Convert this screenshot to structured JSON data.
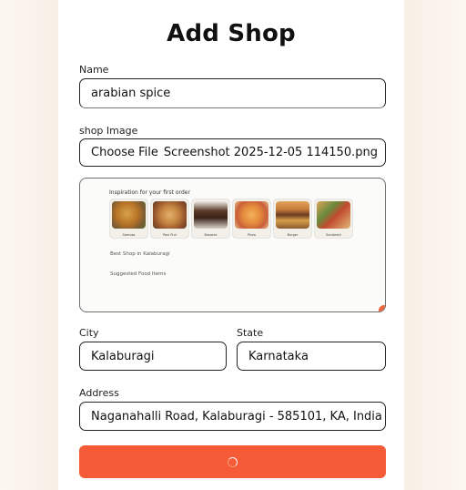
{
  "form": {
    "title": "Add Shop",
    "name_label": "Name",
    "name_value": "arabian spice",
    "image_label": "shop Image",
    "file_button_label": "Choose File",
    "file_name": "Screenshot 2025-12-05 114150.png",
    "preview": {
      "heading": "Inspiration for your first order",
      "items": [
        "Samosa",
        "Pani Puri",
        "Brownie",
        "Pizza",
        "Burger",
        "Sandwich"
      ],
      "line1": "Best Shop in Kalaburagi",
      "line2": "Suggested Food Items"
    },
    "city_label": "City",
    "city_value": "Kalaburagi",
    "state_label": "State",
    "state_value": "Karnataka",
    "address_label": "Address",
    "address_value": "Naganahalli Road, Kalaburagi - 585101, KA, India",
    "accent_color": "#f45b36",
    "submit_icon": "loading-spinner-icon"
  }
}
